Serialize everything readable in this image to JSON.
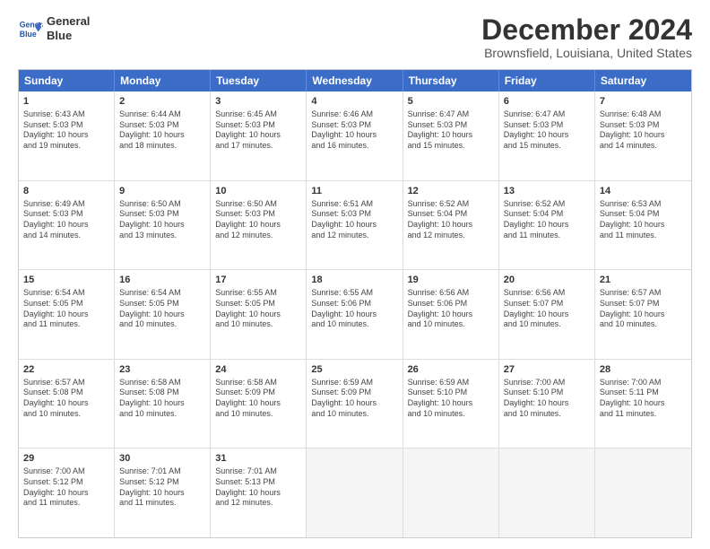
{
  "logo": {
    "line1": "General",
    "line2": "Blue"
  },
  "title": "December 2024",
  "location": "Brownsfield, Louisiana, United States",
  "header_days": [
    "Sunday",
    "Monday",
    "Tuesday",
    "Wednesday",
    "Thursday",
    "Friday",
    "Saturday"
  ],
  "weeks": [
    [
      {
        "day": "1",
        "info": "Sunrise: 6:43 AM\nSunset: 5:03 PM\nDaylight: 10 hours\nand 19 minutes."
      },
      {
        "day": "2",
        "info": "Sunrise: 6:44 AM\nSunset: 5:03 PM\nDaylight: 10 hours\nand 18 minutes."
      },
      {
        "day": "3",
        "info": "Sunrise: 6:45 AM\nSunset: 5:03 PM\nDaylight: 10 hours\nand 17 minutes."
      },
      {
        "day": "4",
        "info": "Sunrise: 6:46 AM\nSunset: 5:03 PM\nDaylight: 10 hours\nand 16 minutes."
      },
      {
        "day": "5",
        "info": "Sunrise: 6:47 AM\nSunset: 5:03 PM\nDaylight: 10 hours\nand 15 minutes."
      },
      {
        "day": "6",
        "info": "Sunrise: 6:47 AM\nSunset: 5:03 PM\nDaylight: 10 hours\nand 15 minutes."
      },
      {
        "day": "7",
        "info": "Sunrise: 6:48 AM\nSunset: 5:03 PM\nDaylight: 10 hours\nand 14 minutes."
      }
    ],
    [
      {
        "day": "8",
        "info": "Sunrise: 6:49 AM\nSunset: 5:03 PM\nDaylight: 10 hours\nand 14 minutes."
      },
      {
        "day": "9",
        "info": "Sunrise: 6:50 AM\nSunset: 5:03 PM\nDaylight: 10 hours\nand 13 minutes."
      },
      {
        "day": "10",
        "info": "Sunrise: 6:50 AM\nSunset: 5:03 PM\nDaylight: 10 hours\nand 12 minutes."
      },
      {
        "day": "11",
        "info": "Sunrise: 6:51 AM\nSunset: 5:03 PM\nDaylight: 10 hours\nand 12 minutes."
      },
      {
        "day": "12",
        "info": "Sunrise: 6:52 AM\nSunset: 5:04 PM\nDaylight: 10 hours\nand 12 minutes."
      },
      {
        "day": "13",
        "info": "Sunrise: 6:52 AM\nSunset: 5:04 PM\nDaylight: 10 hours\nand 11 minutes."
      },
      {
        "day": "14",
        "info": "Sunrise: 6:53 AM\nSunset: 5:04 PM\nDaylight: 10 hours\nand 11 minutes."
      }
    ],
    [
      {
        "day": "15",
        "info": "Sunrise: 6:54 AM\nSunset: 5:05 PM\nDaylight: 10 hours\nand 11 minutes."
      },
      {
        "day": "16",
        "info": "Sunrise: 6:54 AM\nSunset: 5:05 PM\nDaylight: 10 hours\nand 10 minutes."
      },
      {
        "day": "17",
        "info": "Sunrise: 6:55 AM\nSunset: 5:05 PM\nDaylight: 10 hours\nand 10 minutes."
      },
      {
        "day": "18",
        "info": "Sunrise: 6:55 AM\nSunset: 5:06 PM\nDaylight: 10 hours\nand 10 minutes."
      },
      {
        "day": "19",
        "info": "Sunrise: 6:56 AM\nSunset: 5:06 PM\nDaylight: 10 hours\nand 10 minutes."
      },
      {
        "day": "20",
        "info": "Sunrise: 6:56 AM\nSunset: 5:07 PM\nDaylight: 10 hours\nand 10 minutes."
      },
      {
        "day": "21",
        "info": "Sunrise: 6:57 AM\nSunset: 5:07 PM\nDaylight: 10 hours\nand 10 minutes."
      }
    ],
    [
      {
        "day": "22",
        "info": "Sunrise: 6:57 AM\nSunset: 5:08 PM\nDaylight: 10 hours\nand 10 minutes."
      },
      {
        "day": "23",
        "info": "Sunrise: 6:58 AM\nSunset: 5:08 PM\nDaylight: 10 hours\nand 10 minutes."
      },
      {
        "day": "24",
        "info": "Sunrise: 6:58 AM\nSunset: 5:09 PM\nDaylight: 10 hours\nand 10 minutes."
      },
      {
        "day": "25",
        "info": "Sunrise: 6:59 AM\nSunset: 5:09 PM\nDaylight: 10 hours\nand 10 minutes."
      },
      {
        "day": "26",
        "info": "Sunrise: 6:59 AM\nSunset: 5:10 PM\nDaylight: 10 hours\nand 10 minutes."
      },
      {
        "day": "27",
        "info": "Sunrise: 7:00 AM\nSunset: 5:10 PM\nDaylight: 10 hours\nand 10 minutes."
      },
      {
        "day": "28",
        "info": "Sunrise: 7:00 AM\nSunset: 5:11 PM\nDaylight: 10 hours\nand 11 minutes."
      }
    ],
    [
      {
        "day": "29",
        "info": "Sunrise: 7:00 AM\nSunset: 5:12 PM\nDaylight: 10 hours\nand 11 minutes."
      },
      {
        "day": "30",
        "info": "Sunrise: 7:01 AM\nSunset: 5:12 PM\nDaylight: 10 hours\nand 11 minutes."
      },
      {
        "day": "31",
        "info": "Sunrise: 7:01 AM\nSunset: 5:13 PM\nDaylight: 10 hours\nand 12 minutes."
      },
      {
        "day": "",
        "info": ""
      },
      {
        "day": "",
        "info": ""
      },
      {
        "day": "",
        "info": ""
      },
      {
        "day": "",
        "info": ""
      }
    ]
  ]
}
